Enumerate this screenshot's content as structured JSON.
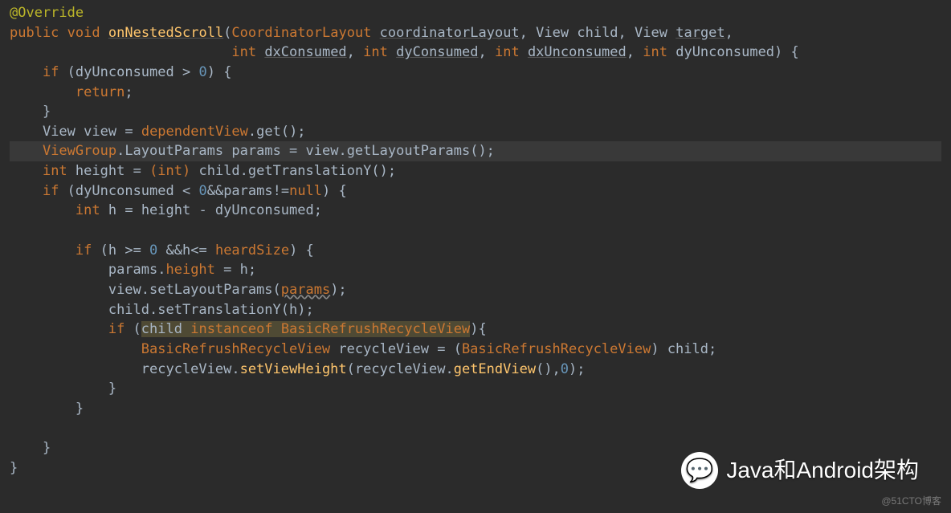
{
  "code": {
    "annotation": "@Override",
    "kw_public": "public",
    "kw_void": "void",
    "method": "onNestedScroll",
    "p_type1": "CoordinatorLayout",
    "p_name1": "coordinatorLayout",
    "p_type2": "View",
    "p_name2": "child",
    "p_type3": "View",
    "p_name3": "target",
    "kw_int": "int",
    "p_dxConsumed": "dxConsumed",
    "p_dyConsumed": "dyConsumed",
    "p_dxUnconsumed": "dxUnconsumed",
    "p_dyUnconsumed": "dyUnconsumed",
    "kw_if": "if",
    "cond1_var": "dyUnconsumed",
    "cond1_op": " > ",
    "cond1_num": "0",
    "kw_return": "return",
    "decl_view_type": "View",
    "decl_view_name": "view",
    "field_dependentView": "dependentView",
    "call_get": ".get();",
    "viewgroup": "ViewGroup",
    "layoutparams": ".LayoutParams",
    "params_name": "params",
    "assign_params": " = view.getLayoutParams();",
    "decl_height_kw": "int",
    "decl_height_name": "height",
    "cast_int": "(int)",
    "child_getTransY": " child.getTranslationY();",
    "cond2_var": "dyUnconsumed",
    "cond2_op": " < ",
    "cond2_num": "0",
    "cond2_rest": "&&params!=",
    "kw_null": "null",
    "decl_h_kw": "int",
    "decl_h_name": "h",
    "decl_h_expr": " = height - dyUnconsumed;",
    "cond3_lhs": "h >= ",
    "cond3_zero": "0",
    "cond3_mid": " &&h<= ",
    "field_heardSize": "heardSize",
    "stmt_params_height": "params.",
    "field_height": "height",
    "stmt_params_height_rhs": " = h;",
    "stmt_setLayoutParams": "view.setLayoutParams(",
    "stmt_setLayoutParams_arg": "params",
    "stmt_setLayoutParams_end": ");",
    "stmt_setTransY": "child.setTranslationY(h);",
    "cond4_child": "child ",
    "kw_instanceof": "instanceof",
    "cond4_class": " BasicRefrushRecycleView",
    "decl_recycle_type": "BasicRefrushRecycleView",
    "decl_recycle_name": " recycleView = (",
    "cast_recycle_type": "BasicRefrushRecycleView",
    "decl_recycle_end": ") child;",
    "stmt_recycle_obj": "recycleView.",
    "call_setViewHeight": "setViewHeight",
    "stmt_recycle_args1": "(recycleView.",
    "call_getEndView": "getEndView",
    "stmt_recycle_args2": "(),",
    "arg_zero": "0",
    "stmt_recycle_end": ");"
  },
  "watermark": "@51CTO博客",
  "wechat_label": "Java和Android架构"
}
